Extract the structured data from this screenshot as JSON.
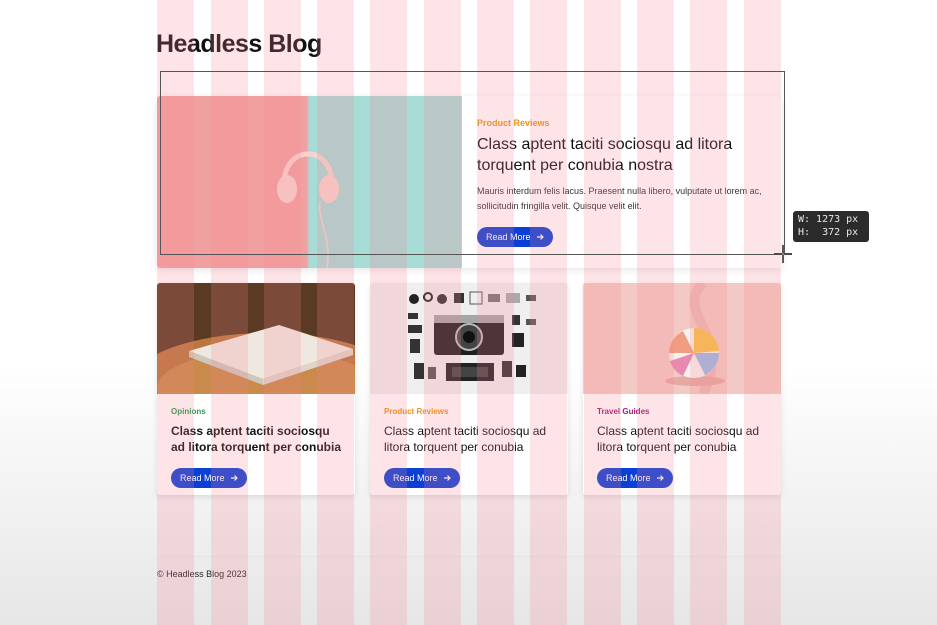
{
  "site": {
    "title": "Headless Blog"
  },
  "hero": {
    "category": "Product Reviews",
    "title": "Class aptent taciti sociosqu ad litora torquent per conubia nostra",
    "excerpt": "Mauris interdum felis lacus. Praesent nulla libero, vulputate ut lorem ac, sollicitudin fringilla velit. Quisque velit elit.",
    "button": "Read More",
    "image_icon": "headphones-image"
  },
  "cards": [
    {
      "category": "Opinions",
      "title": "Class aptent taciti sociosqu ad litora torquent per conubia",
      "button": "Read More",
      "category_color": "#2e9a54",
      "image_icon": "book-on-table-image"
    },
    {
      "category": "Product Reviews",
      "title": "Class aptent taciti sociosqu ad litora torquent per conubia",
      "button": "Read More",
      "category_color": "#e8951a",
      "image_icon": "camera-flatlay-image"
    },
    {
      "category": "Travel Guides",
      "title": "Class aptent taciti sociosqu ad litora torquent per conubia",
      "button": "Read More",
      "category_color": "#a11c79",
      "image_icon": "beach-ball-image"
    }
  ],
  "measure": {
    "width": "W: 1273 px",
    "height": "H:  372 px"
  },
  "footer": {
    "text": "© Headless Blog 2023"
  },
  "colors": {
    "accent": "#0b3fd6",
    "grid_overlay": "#f5828c"
  },
  "icons": {
    "arrow": "arrow-right-icon",
    "crosshair": "crosshair-icon"
  }
}
